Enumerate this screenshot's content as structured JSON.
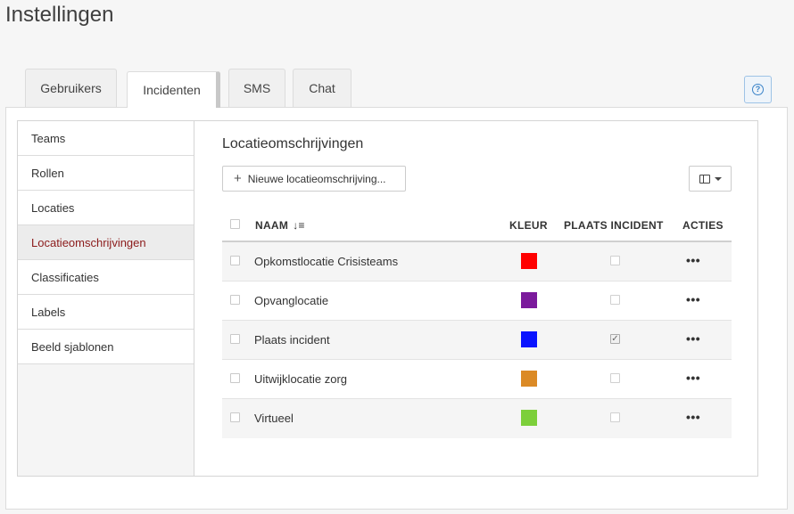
{
  "page": {
    "title": "Instellingen"
  },
  "tabs": [
    {
      "label": "Gebruikers"
    },
    {
      "label": "Incidenten"
    },
    {
      "label": "SMS"
    },
    {
      "label": "Chat"
    }
  ],
  "help": {
    "icon": "question-icon",
    "glyph": "?"
  },
  "sidebar": {
    "items": [
      {
        "label": "Teams"
      },
      {
        "label": "Rollen"
      },
      {
        "label": "Locaties"
      },
      {
        "label": "Locatieomschrijvingen"
      },
      {
        "label": "Classificaties"
      },
      {
        "label": "Labels"
      },
      {
        "label": "Beeld sjablonen"
      }
    ],
    "active_index": 3
  },
  "main": {
    "title": "Locatieomschrijvingen",
    "new_button": {
      "icon": "plus-icon",
      "glyph": "+",
      "label": "Nieuwe locatieomschrijving..."
    },
    "columns_button": {
      "icon": "columns-icon"
    },
    "table": {
      "headers": {
        "name": "NAAM",
        "sort_icon": "sort-alpha-icon",
        "sort_glyph": "↓≡",
        "color": "KLEUR",
        "incident": "PLAATS INCIDENT",
        "actions": "ACTIES"
      },
      "rows": [
        {
          "name": "Opkomstlocatie Crisisteams",
          "color": "#ff0000",
          "incident": false,
          "actions": "•••"
        },
        {
          "name": "Opvanglocatie",
          "color": "#7b1a9c",
          "incident": false,
          "actions": "•••"
        },
        {
          "name": "Plaats incident",
          "color": "#0a14ff",
          "incident": true,
          "actions": "•••"
        },
        {
          "name": "Uitwijklocatie zorg",
          "color": "#db8a26",
          "incident": false,
          "actions": "•••"
        },
        {
          "name": "Virtueel",
          "color": "#7ccf3a",
          "incident": false,
          "actions": "•••"
        }
      ]
    }
  }
}
